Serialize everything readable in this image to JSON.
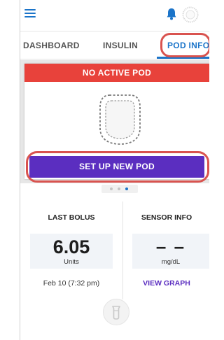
{
  "tabs": {
    "dashboard": "DASHBOARD",
    "insulin": "INSULIN",
    "pod_info": "POD INFO"
  },
  "pod_banner": "NO ACTIVE POD",
  "setup_button": "SET UP NEW POD",
  "pager": {
    "pages": 3,
    "active": 3
  },
  "last_bolus": {
    "label": "LAST BOLUS",
    "value": "6.05",
    "units": "Units",
    "date": "Feb 10 (7:32 pm)"
  },
  "sensor_info": {
    "label": "SENSOR INFO",
    "value": "– –",
    "units": "mg/dL",
    "link": "VIEW GRAPH"
  },
  "colors": {
    "accent_blue": "#1b74c9",
    "alert_red": "#e8423b",
    "button_purple": "#5b2ec0",
    "highlight_red": "#d9534f"
  },
  "icons": {
    "menu": "hamburger-menu-icon",
    "notifications": "bell-icon",
    "pod_status": "pod-status-ring-icon",
    "pod": "pod-outline-icon",
    "bolus": "bolus-icon"
  }
}
